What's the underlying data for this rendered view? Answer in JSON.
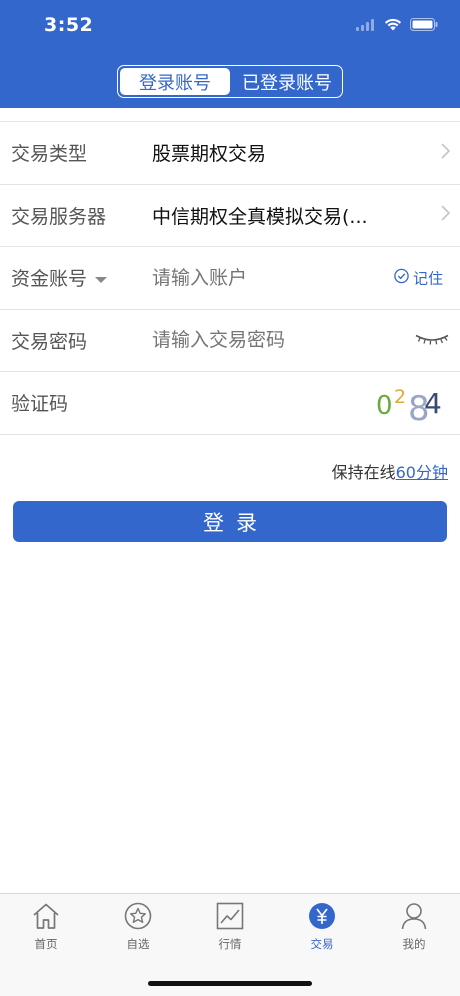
{
  "status": {
    "time": "3:52"
  },
  "segment": {
    "tabs": [
      "登录账号",
      "已登录账号"
    ],
    "active_index": 0
  },
  "form": {
    "trade_type": {
      "label": "交易类型",
      "value": "股票期权交易"
    },
    "trade_server": {
      "label": "交易服务器",
      "value": "中信期权全真模拟交易(..."
    },
    "fund_account": {
      "label": "资金账号",
      "placeholder": "请输入账户",
      "remember_label": "记住"
    },
    "trade_password": {
      "label": "交易密码",
      "placeholder": "请输入交易密码"
    },
    "verification": {
      "label": "验证码",
      "captcha_chars": [
        "0",
        "2",
        "8",
        "4"
      ],
      "captcha_colors": [
        "#6aaa3c",
        "#e0a93a",
        "#9aa6c8",
        "#3a4a6e"
      ]
    }
  },
  "keep_online": {
    "prefix": "保持在线",
    "link": "60分钟"
  },
  "login_button": {
    "label": "登录"
  },
  "tabbar": {
    "items": [
      {
        "label": "首页",
        "icon": "home-icon"
      },
      {
        "label": "自选",
        "icon": "star-icon"
      },
      {
        "label": "行情",
        "icon": "chart-icon"
      },
      {
        "label": "交易",
        "icon": "yen-icon"
      },
      {
        "label": "我的",
        "icon": "person-icon"
      }
    ],
    "active_index": 3
  },
  "colors": {
    "brand": "#3467cc",
    "link": "#3467cc"
  }
}
